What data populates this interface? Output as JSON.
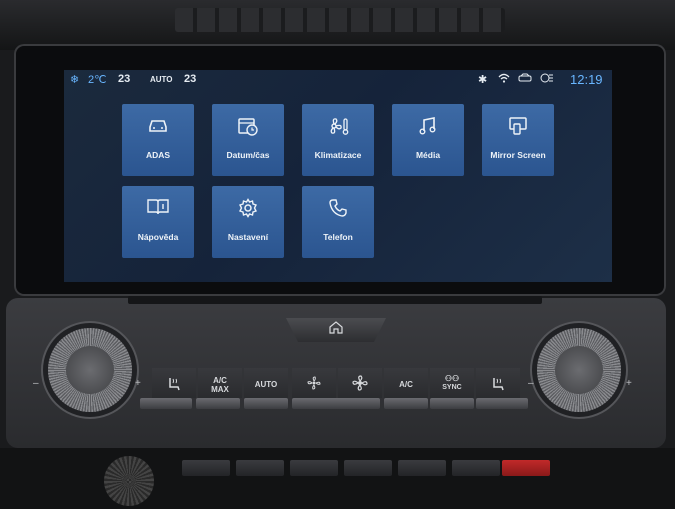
{
  "status": {
    "snowflake_icon": "snowflake-icon",
    "left_temp": "2℃",
    "driver_set": "23",
    "mode": "AUTO",
    "passenger_set": "23",
    "clock": "12:19"
  },
  "tiles": [
    {
      "label": "ADAS",
      "icon": "car-icon"
    },
    {
      "label": "Datum/čas",
      "icon": "calendar-clock-icon"
    },
    {
      "label": "Klimatizace",
      "icon": "fan-thermometer-icon"
    },
    {
      "label": "Média",
      "icon": "music-note-icon"
    },
    {
      "label": "Mirror Screen",
      "icon": "mirror-screen-icon"
    },
    {
      "label": "Nápověda",
      "icon": "book-info-icon"
    },
    {
      "label": "Nastavení",
      "icon": "gear-icon"
    },
    {
      "label": "Telefon",
      "icon": "phone-icon"
    }
  ],
  "climate": {
    "ac_max": "A/C\nMAX",
    "auto": "AUTO",
    "ac": "A/C",
    "sync": "SYNC"
  },
  "knobs": {
    "minus": "–",
    "plus": "+"
  },
  "colors": {
    "tile": "#3d6aa5",
    "accent_text": "#69b6ff",
    "led": "#e07a2a"
  }
}
